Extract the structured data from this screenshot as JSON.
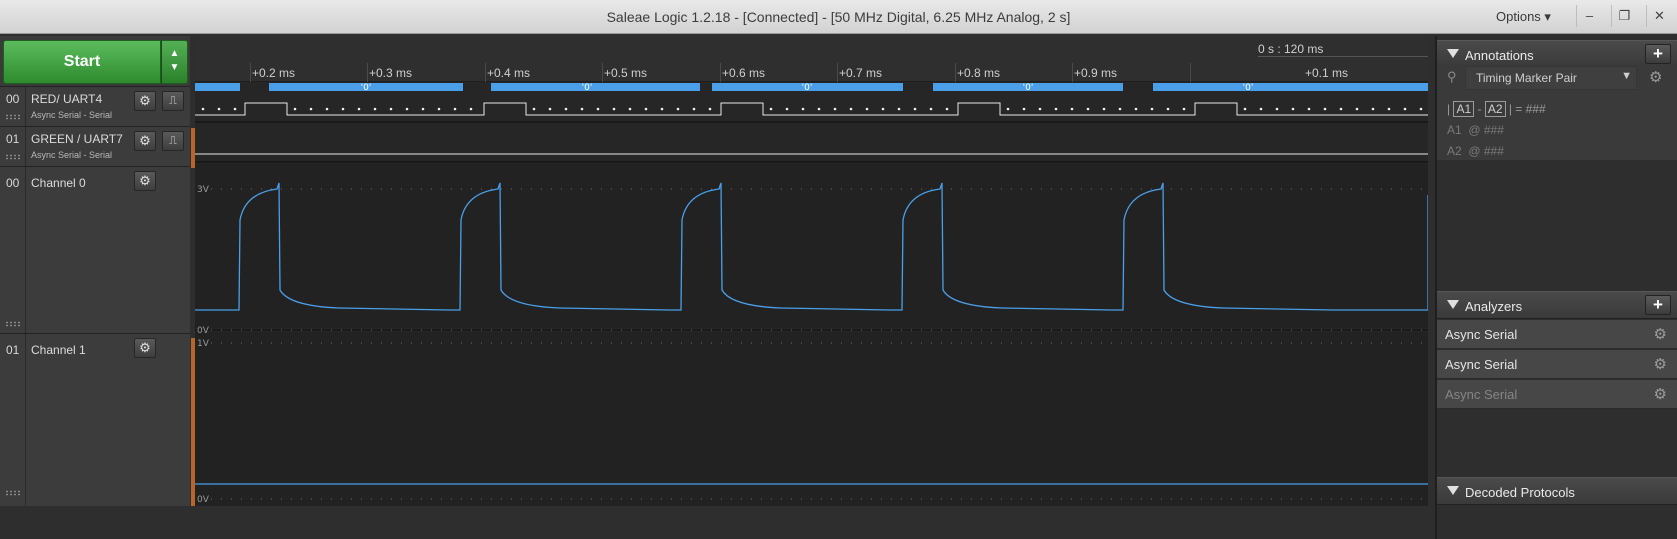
{
  "window": {
    "title": "Saleae Logic 1.2.18 - [Connected] - [50 MHz Digital, 6.25 MHz Analog, 2 s]",
    "options_label": "Options ▾",
    "minimize": "–",
    "restore": "❐",
    "close": "✕"
  },
  "toolbar": {
    "start_label": "Start",
    "up_arrow": "▲",
    "down_arrow": "▼"
  },
  "time_axis": {
    "cursor_label": "0 s : 120 ms",
    "ticks": [
      "+0.2 ms",
      "+0.3 ms",
      "+0.4 ms",
      "+0.5 ms",
      "+0.6 ms",
      "+0.7 ms",
      "+0.8 ms",
      "+0.9 ms",
      "+0.1 ms"
    ]
  },
  "channels": [
    {
      "num": "00",
      "name": "RED/ UART4",
      "sub": "Async Serial - Serial"
    },
    {
      "num": "01",
      "name": "GREEN / UART7",
      "sub": "Async Serial - Serial"
    },
    {
      "num": "00",
      "name": "Channel 0",
      "scale_top": "3V",
      "scale_bottom": "0V"
    },
    {
      "num": "01",
      "name": "Channel 1",
      "scale_top": "1V",
      "scale_bottom": "0V"
    }
  ],
  "decoded_frames": [
    "'0'",
    "'0'",
    "'0'",
    "'0'",
    "'0'"
  ],
  "annotations": {
    "title": "Annotations",
    "marker_select": "Timing Marker Pair",
    "pair_line_a1": "A1",
    "pair_line_a2": "A2",
    "pair_line_value": "= ###",
    "a1_label": "A1",
    "a1_value": "@ ###",
    "a2_label": "A2",
    "a2_value": "@ ###"
  },
  "analyzers": {
    "title": "Analyzers",
    "items": [
      {
        "label": "Async Serial",
        "enabled": true
      },
      {
        "label": "Async Serial",
        "enabled": true
      },
      {
        "label": "Async Serial",
        "enabled": false
      }
    ]
  },
  "decoded_protocols": {
    "title": "Decoded Protocols"
  },
  "colors": {
    "trace": "#4a9fe8",
    "start_green": "#3a9e3a",
    "orange_marker": "#b8652c"
  },
  "icons": {
    "gear": "⚙",
    "plus": "+",
    "trigger": "trigger-icon"
  }
}
